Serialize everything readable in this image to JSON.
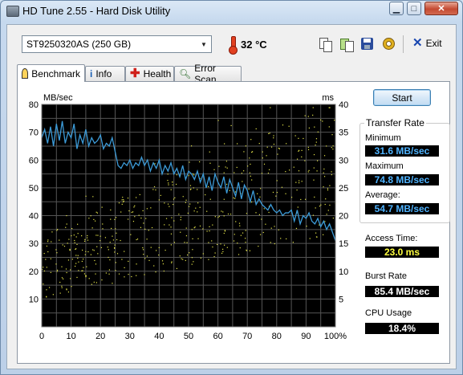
{
  "window": {
    "title": "HD Tune 2.55 - Hard Disk Utility",
    "minimize_glyph": "▁",
    "maximize_glyph": "□",
    "close_glyph": "✕"
  },
  "toolbar": {
    "drive": "ST9250320AS (250 GB)",
    "temperature": "32 °C",
    "copy_icon": "copy-icon",
    "paste_icon": "copy-info-icon",
    "save_icon": "save-icon",
    "options_icon": "options-icon",
    "exit_label": "Exit"
  },
  "tabs": [
    {
      "label": "Benchmark",
      "icon": "benchmark-icon"
    },
    {
      "label": "Info",
      "icon": "info-icon"
    },
    {
      "label": "Health",
      "icon": "health-icon"
    },
    {
      "label": "Error Scan",
      "icon": "error-scan-icon"
    }
  ],
  "benchmark": {
    "start_label": "Start",
    "transfer_rate_title": "Transfer Rate",
    "minimum_label": "Minimum",
    "minimum_value": "31.6 MB/sec",
    "maximum_label": "Maximum",
    "maximum_value": "74.8 MB/sec",
    "average_label": "Average:",
    "average_value": "54.7 MB/sec",
    "access_time_label": "Access Time:",
    "access_time_value": "23.0 ms",
    "burst_rate_label": "Burst Rate",
    "burst_rate_value": "85.4 MB/sec",
    "cpu_usage_label": "CPU Usage",
    "cpu_usage_value": "18.4%"
  },
  "chart_data": {
    "type": "line",
    "ylabel_left": "MB/sec",
    "ylabel_right": "ms",
    "x_ticks": [
      "0",
      "10",
      "20",
      "30",
      "40",
      "50",
      "60",
      "70",
      "80",
      "90",
      "100%"
    ],
    "y_left_ticks": [
      "80",
      "70",
      "60",
      "50",
      "40",
      "30",
      "20",
      "10"
    ],
    "y_right_ticks": [
      "40",
      "35",
      "30",
      "25",
      "20",
      "15",
      "10",
      "5"
    ],
    "xlim": [
      0,
      100
    ],
    "ylim_left": [
      0,
      80
    ],
    "ylim_right": [
      0,
      40
    ],
    "grid": true,
    "series": [
      {
        "name": "",
        "axis": "left",
        "color": "#3c9bd8",
        "x": [
          0,
          1,
          2,
          3,
          4,
          5,
          6,
          7,
          8,
          9,
          10,
          11,
          12,
          13,
          14,
          15,
          16,
          17,
          18,
          19,
          20,
          21,
          22,
          23,
          24,
          25,
          26,
          27,
          28,
          29,
          30,
          31,
          32,
          33,
          34,
          35,
          36,
          37,
          38,
          39,
          40,
          41,
          42,
          43,
          44,
          45,
          46,
          47,
          48,
          49,
          50,
          51,
          52,
          53,
          54,
          55,
          56,
          57,
          58,
          59,
          60,
          61,
          62,
          63,
          64,
          65,
          66,
          67,
          68,
          69,
          70,
          71,
          72,
          73,
          74,
          75,
          76,
          77,
          78,
          79,
          80,
          81,
          82,
          83,
          84,
          85,
          86,
          87,
          88,
          89,
          90,
          91,
          92,
          93,
          94,
          95,
          96,
          97,
          98,
          99,
          100
        ],
        "y": [
          68,
          71,
          66,
          72,
          65,
          73,
          67,
          74,
          66,
          70,
          68,
          73,
          64,
          69,
          66,
          71,
          65,
          68,
          66,
          67,
          69,
          64,
          66,
          65,
          68,
          63,
          58,
          57,
          59,
          58,
          60,
          57,
          59,
          58,
          61,
          58,
          60,
          56,
          59,
          57,
          60,
          55,
          58,
          56,
          59,
          55,
          57,
          54,
          58,
          53,
          56,
          55,
          53,
          56,
          52,
          55,
          50,
          54,
          49,
          55,
          52,
          50,
          54,
          48,
          53,
          50,
          47,
          52,
          46,
          51,
          49,
          45,
          49,
          44,
          46,
          44,
          43,
          42,
          44,
          42,
          41,
          42,
          40,
          41,
          41,
          42,
          38,
          42,
          37,
          40,
          39,
          41,
          38,
          37,
          39,
          36,
          38,
          35,
          37,
          34,
          31
        ]
      },
      {
        "name": "",
        "axis": "right",
        "type": "scatter",
        "color": "#e6e64a"
      }
    ]
  }
}
